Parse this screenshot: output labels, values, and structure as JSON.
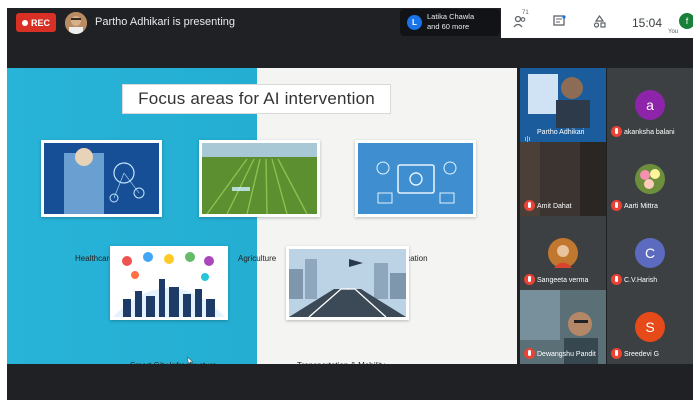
{
  "rec": {
    "label": "REC"
  },
  "presenter": {
    "text": "Partho Adhikari is presenting"
  },
  "people": {
    "initial": "L",
    "line1": "Latika Chawla",
    "line2": "and 60 more"
  },
  "controls": {
    "participants_count": "71",
    "clock": "15:04",
    "you_initial": "f",
    "you_label": "You"
  },
  "slide": {
    "title": "Focus areas for AI intervention",
    "tiles": [
      {
        "caption": "Healthcare"
      },
      {
        "caption": "Agriculture"
      },
      {
        "caption": "Education"
      },
      {
        "caption": "Smart City Infrastructure"
      },
      {
        "caption": "Transportation & Mobility"
      }
    ]
  },
  "participants": [
    {
      "name": "Partho Adhikari",
      "type": "video"
    },
    {
      "name": "akanksha balani",
      "initial": "a",
      "color": "#8e24aa"
    },
    {
      "name": "Amit Dahat",
      "type": "video"
    },
    {
      "name": "Aarti Mittra",
      "type": "photo"
    },
    {
      "name": "Sangeeta verma",
      "type": "photo"
    },
    {
      "name": "C.V.Harish",
      "initial": "C",
      "color": "#5c6bc0"
    },
    {
      "name": "Dewangshu Pandit",
      "type": "video"
    },
    {
      "name": "Sreedevi G",
      "initial": "S",
      "color": "#e64a19"
    }
  ],
  "colors": {
    "slide_blue": "#28b3d8",
    "rec_red": "#d93025",
    "meet_dark": "#202124"
  }
}
